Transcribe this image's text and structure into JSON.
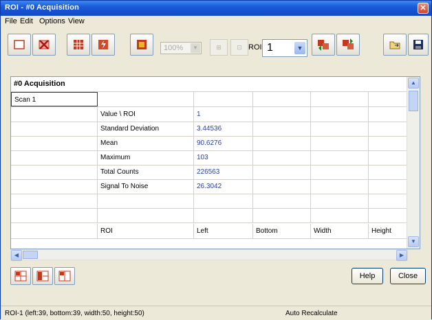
{
  "window": {
    "title": "ROI - #0 Acquisition",
    "close_glyph": "✕"
  },
  "menu": [
    "File",
    "Edit",
    "Options",
    "View"
  ],
  "toolbar": {
    "zoom_value": "100%",
    "roi_label": "ROI",
    "roi_value": "1",
    "icons": [
      "new-roi-icon",
      "delete-roi-icon",
      "grid-roi-icon",
      "roi-tool-icon",
      "color-icon",
      "zoom-icon",
      "copy-icon",
      "paste-icon",
      "roi-prev-icon",
      "roi-next-icon",
      "open-file-icon",
      "save-icon"
    ],
    "accent": "#c23a1e"
  },
  "grid": {
    "header": "#0 Acquisition",
    "scan_label": "Scan 1",
    "stats_rows": [
      {
        "name": "Value \\ ROI",
        "value": "1"
      },
      {
        "name": "Standard Deviation",
        "value": "3.44536"
      },
      {
        "name": "Mean",
        "value": "90.6276"
      },
      {
        "name": "Maximum",
        "value": "103"
      },
      {
        "name": "Total Counts",
        "value": "226563"
      },
      {
        "name": "Signal To Noise",
        "value": "26.3042"
      }
    ],
    "geom_header": [
      "ROI",
      "Left",
      "Bottom",
      "Width",
      "Height"
    ]
  },
  "buttons": {
    "help": "Help",
    "close": "Close"
  },
  "status": {
    "left": "ROI-1 (left:39, bottom:39, width:50, height:50)",
    "right": "Auto Recalculate"
  }
}
